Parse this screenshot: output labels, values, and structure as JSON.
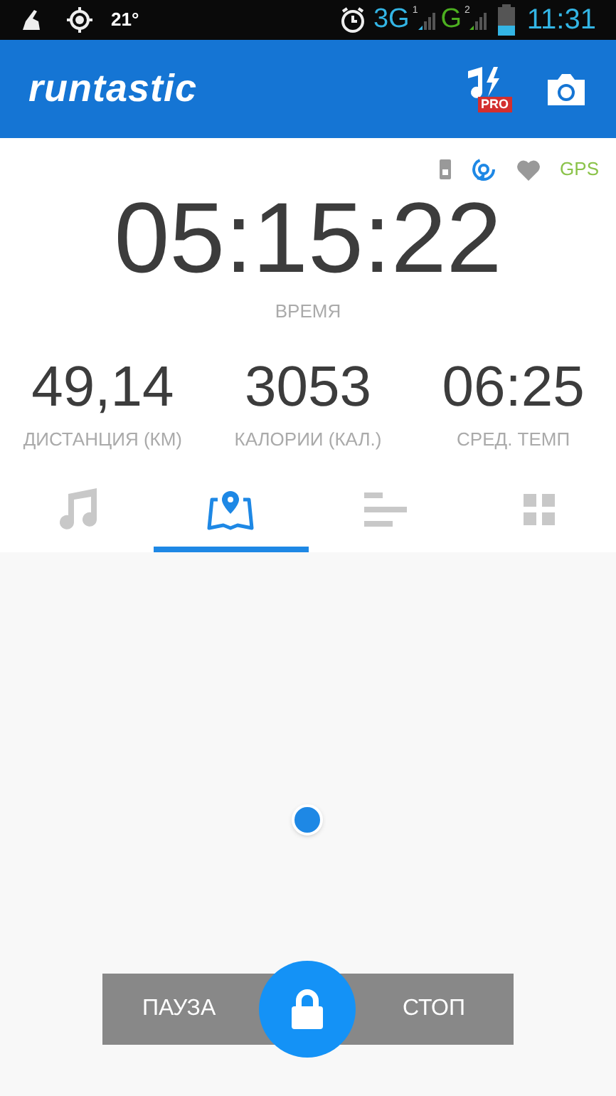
{
  "status_bar": {
    "temperature": "21°",
    "network_1": "3G",
    "sim_1": "1",
    "network_2": "G",
    "sim_2": "2",
    "time": "11:31"
  },
  "app_bar": {
    "logo": "runtastic",
    "badge": "PRO"
  },
  "indicators": {
    "gps": "GPS"
  },
  "timer": {
    "value": "05:15:22",
    "label": "ВРЕМЯ"
  },
  "stats": [
    {
      "value": "49,14",
      "label": "ДИСТАНЦИЯ (КМ)"
    },
    {
      "value": "3053",
      "label": "КАЛОРИИ (КАЛ.)"
    },
    {
      "value": "06:25",
      "label": "СРЕД. ТЕМП"
    }
  ],
  "tabs": [
    {
      "kind": "music",
      "selected": false
    },
    {
      "kind": "map",
      "selected": true
    },
    {
      "kind": "bars",
      "selected": false
    },
    {
      "kind": "grid",
      "selected": false
    }
  ],
  "controls": {
    "pause": "ПАУЗА",
    "stop": "СТОП"
  }
}
